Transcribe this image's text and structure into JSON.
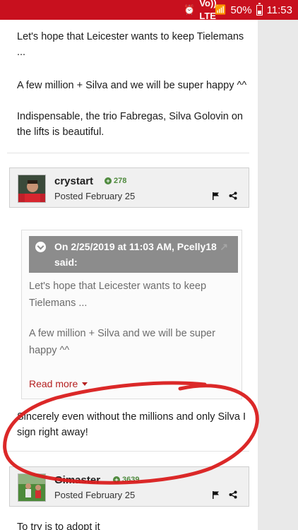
{
  "status_bar": {
    "volte": "Vo)) LTE",
    "battery_percent": "50%",
    "time": "11:53"
  },
  "post_text": {
    "line1": "Let's hope that Leicester wants to keep Tielemans ...",
    "line2": "A few million + Silva and we will be super happy ^^",
    "line3": "Indispensable, the trio Fabregas, Silva Golovin on the lifts is beautiful."
  },
  "post1": {
    "username": "crystart",
    "reputation": "278",
    "posted": "Posted February 25",
    "quote": {
      "header": "On 2/25/2019 at 11:03 AM, Pcelly18 said:",
      "text1": "Let's hope that Leicester wants to keep Tielemans ...",
      "text2": "A few million + Silva and we will be super happy ^^",
      "read_more": "Read more"
    },
    "reply": "Sincerely even without the millions and only Silva I sign right away!"
  },
  "post2": {
    "username": "Gimaster",
    "reputation": "3639",
    "posted": "Posted February 25",
    "text_preview": "To try is to adopt it"
  },
  "colors": {
    "status_bar": "#c8101e",
    "reputation_green": "#4f8a3e",
    "read_more": "#b52020",
    "annotation_circle": "#d91c1c"
  }
}
